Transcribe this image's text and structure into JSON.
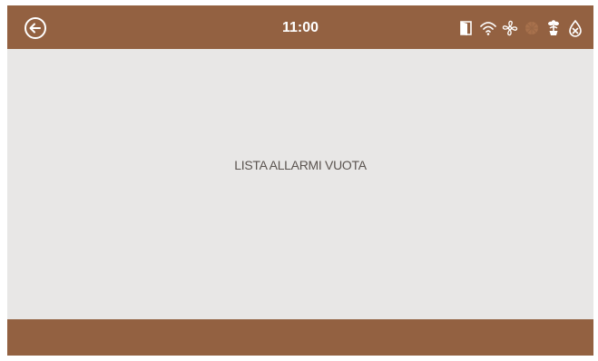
{
  "header": {
    "time": "11:00",
    "back_icon": "arrow-left-circle-icon",
    "status_icons": [
      "door-icon",
      "wifi-icon",
      "fan-icon",
      "heater-icon",
      "plant-icon",
      "water-off-icon"
    ]
  },
  "main": {
    "empty_message": "LISTA ALLARMI VUOTA"
  },
  "colors": {
    "bar": "#936141",
    "background": "#e8e7e6",
    "text": "#5b5450",
    "inactive_icon": "#a8714c"
  }
}
